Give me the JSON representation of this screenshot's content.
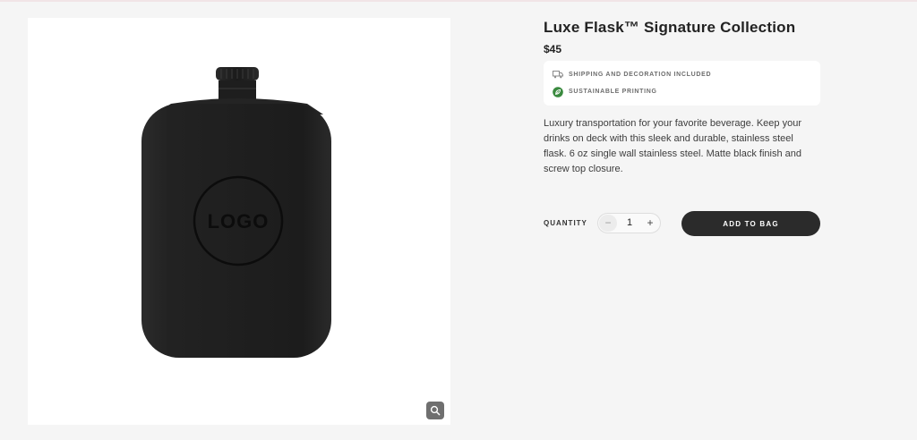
{
  "product": {
    "title": "Luxe Flask™ Signature Collection",
    "price": "$45",
    "image": {
      "logo_text": "LOGO",
      "zoom_icon": "magnifier-icon"
    },
    "perks": [
      {
        "icon": "truck-icon",
        "label": "SHIPPING AND DECORATION INCLUDED"
      },
      {
        "icon": "leaf-badge-icon",
        "label": "SUSTAINABLE PRINTING",
        "color": "#3a8a3f"
      }
    ],
    "description": "Luxury transportation for your favorite beverage. Keep your drinks on deck with this sleek and durable, stainless steel flask. 6 oz single wall stainless steel. Matte black finish and screw top closure."
  },
  "purchase": {
    "quantity_label": "QUANTITY",
    "quantity": "1",
    "minus": "−",
    "plus": "+",
    "add_to_bag": "ADD TO BAG"
  },
  "colors": {
    "background": "#f5f5f5",
    "button": "#2b2b2b",
    "flask": "#1f1f1f",
    "accent_green": "#3a8a3f"
  }
}
